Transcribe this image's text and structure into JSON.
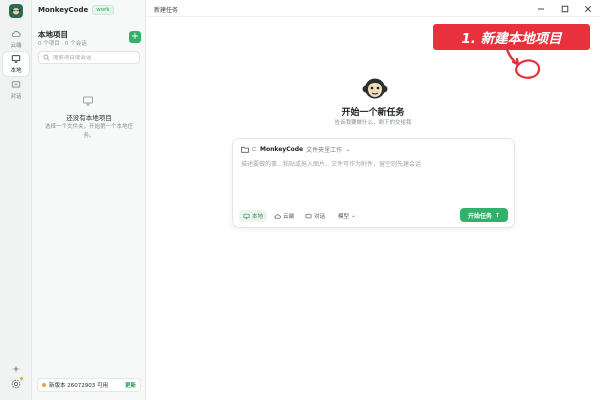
{
  "rail": {
    "items": [
      {
        "label": "云端",
        "icon": "cloud-icon"
      },
      {
        "label": "本地",
        "icon": "monitor-icon"
      },
      {
        "label": "对话",
        "icon": "chat-icon"
      }
    ]
  },
  "sidebar": {
    "app_name": "MonkeyCode",
    "env_badge": "work",
    "section_title": "本地项目",
    "section_sub": "0 个项目 · 0 个会话",
    "search_placeholder": "搜索项目或会话",
    "empty_title": "还没有本地项目",
    "empty_desc": "选择一个文件夹，开始第一个本地任务。",
    "update_text": "新版本 26072903 可用",
    "update_link": "更新"
  },
  "titlebar": {
    "tab": "新建任务"
  },
  "hero": {
    "title": "开始一个新任务",
    "subtitle": "告诉我要做什么，剩下的交给我"
  },
  "composer": {
    "project_name": "MonkeyCode",
    "workspace_label": "文件夹里工作",
    "placeholder": "描述要做的事…粘贴或拖入图片、文件可作为附件，留空则先建会话",
    "modes": [
      {
        "label": "本地",
        "active": true
      },
      {
        "label": "云端",
        "active": false
      },
      {
        "label": "对话",
        "active": false
      }
    ],
    "model_label": "模型",
    "start_label": "开始任务"
  },
  "annotation": {
    "text": "1. 新建本地项目",
    "color": "#e8313d"
  },
  "colors": {
    "accent": "#2fb26a",
    "brand_dark": "#2d6a4f",
    "notice": "#e8a43a"
  }
}
